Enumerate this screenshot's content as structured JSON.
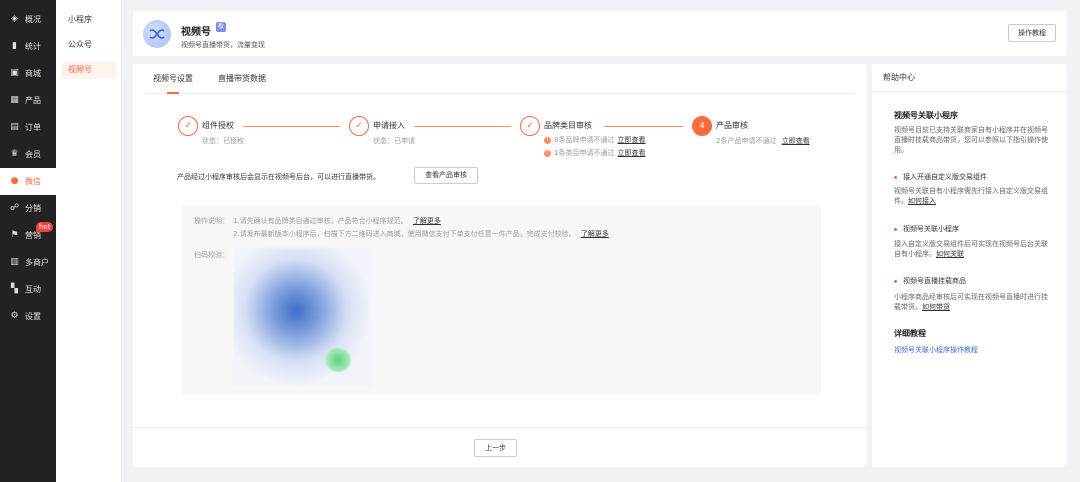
{
  "sidebar": {
    "items": [
      {
        "label": "概况",
        "icon": "layers-icon"
      },
      {
        "label": "统计",
        "icon": "bar-chart-icon"
      },
      {
        "label": "商城",
        "icon": "shop-icon"
      },
      {
        "label": "产品",
        "icon": "grid-icon"
      },
      {
        "label": "订单",
        "icon": "order-icon"
      },
      {
        "label": "会员",
        "icon": "crown-icon"
      },
      {
        "label": "微信",
        "icon": "wechat-icon"
      },
      {
        "label": "分销",
        "icon": "share-icon"
      },
      {
        "label": "营销",
        "icon": "flag-icon",
        "badge": "hot"
      },
      {
        "label": "多商户",
        "icon": "store-icon"
      },
      {
        "label": "互动",
        "icon": "interact-icon"
      },
      {
        "label": "设置",
        "icon": "gear-icon"
      }
    ]
  },
  "subnav": {
    "items": [
      "小程序",
      "公众号",
      "视频号"
    ]
  },
  "header": {
    "title": "视频号",
    "badge": "板",
    "subtitle": "视频号直播带货，流量变现",
    "tutorial_label": "操作教程"
  },
  "tabs": [
    "视频号设置",
    "直播带货数据"
  ],
  "steps": [
    {
      "number": "✓",
      "title": "组件授权",
      "status": "状态：已授权"
    },
    {
      "number": "✓",
      "title": "申请接入",
      "status": "状态：已申请"
    },
    {
      "number": "✓",
      "title": "品牌类目审核",
      "warnings": [
        {
          "text": "8条品牌申请不通过",
          "link": "立即查看"
        },
        {
          "text": "1条类目申请不通过",
          "link": "立即查看"
        }
      ]
    },
    {
      "number": "4",
      "title": "产品审核",
      "status": "2条产品申请不通过",
      "link": "立即查看"
    }
  ],
  "notice": "产品经过小程序审核后会显示在视频号后台，可以进行直播带货。",
  "check_button": "查看产品审核",
  "instructions": {
    "label": "操作说明：",
    "line1": "1.请先确认有品牌类目通过审核，产品符合小程序规范。",
    "line1_link": "了解更多",
    "line2": "2.请发布最新版本小程序后，扫描下方二维码进入商城，使用微信支付下单支付任意一件产品，完成支付校验。",
    "line2_link": "了解更多",
    "scan_label": "扫码校验："
  },
  "prev_button": "上一步",
  "help": {
    "header": "帮助中心",
    "section_title": "视频号关联小程序",
    "section_text": "视频号目前已支持关联商家自有小程序并在视频号直播时挂载商品带货，您可以参照以下指引操作使用。",
    "items": [
      {
        "title": "接入开通自定义版交易组件",
        "text": "视频号关联自有小程序需先行接入自定义版交易组件。",
        "link": "如何接入"
      },
      {
        "title": "视频号关联小程序",
        "text": "接入自定义版交易组件后可实现在视频号后台关联自有小程序。",
        "link": "如何关联"
      },
      {
        "title": "视频号直播挂载商品",
        "text": "小程序商品经审核后可实现在视频号直播时进行挂载带货。",
        "link": "如何带货"
      }
    ],
    "detail_title": "详细教程",
    "detail_link": "视频号关联小程序操作教程"
  },
  "colors": {
    "accent": "#ff6a3d",
    "sidebar_bg": "#222222",
    "link_blue": "#3a6fd1"
  }
}
